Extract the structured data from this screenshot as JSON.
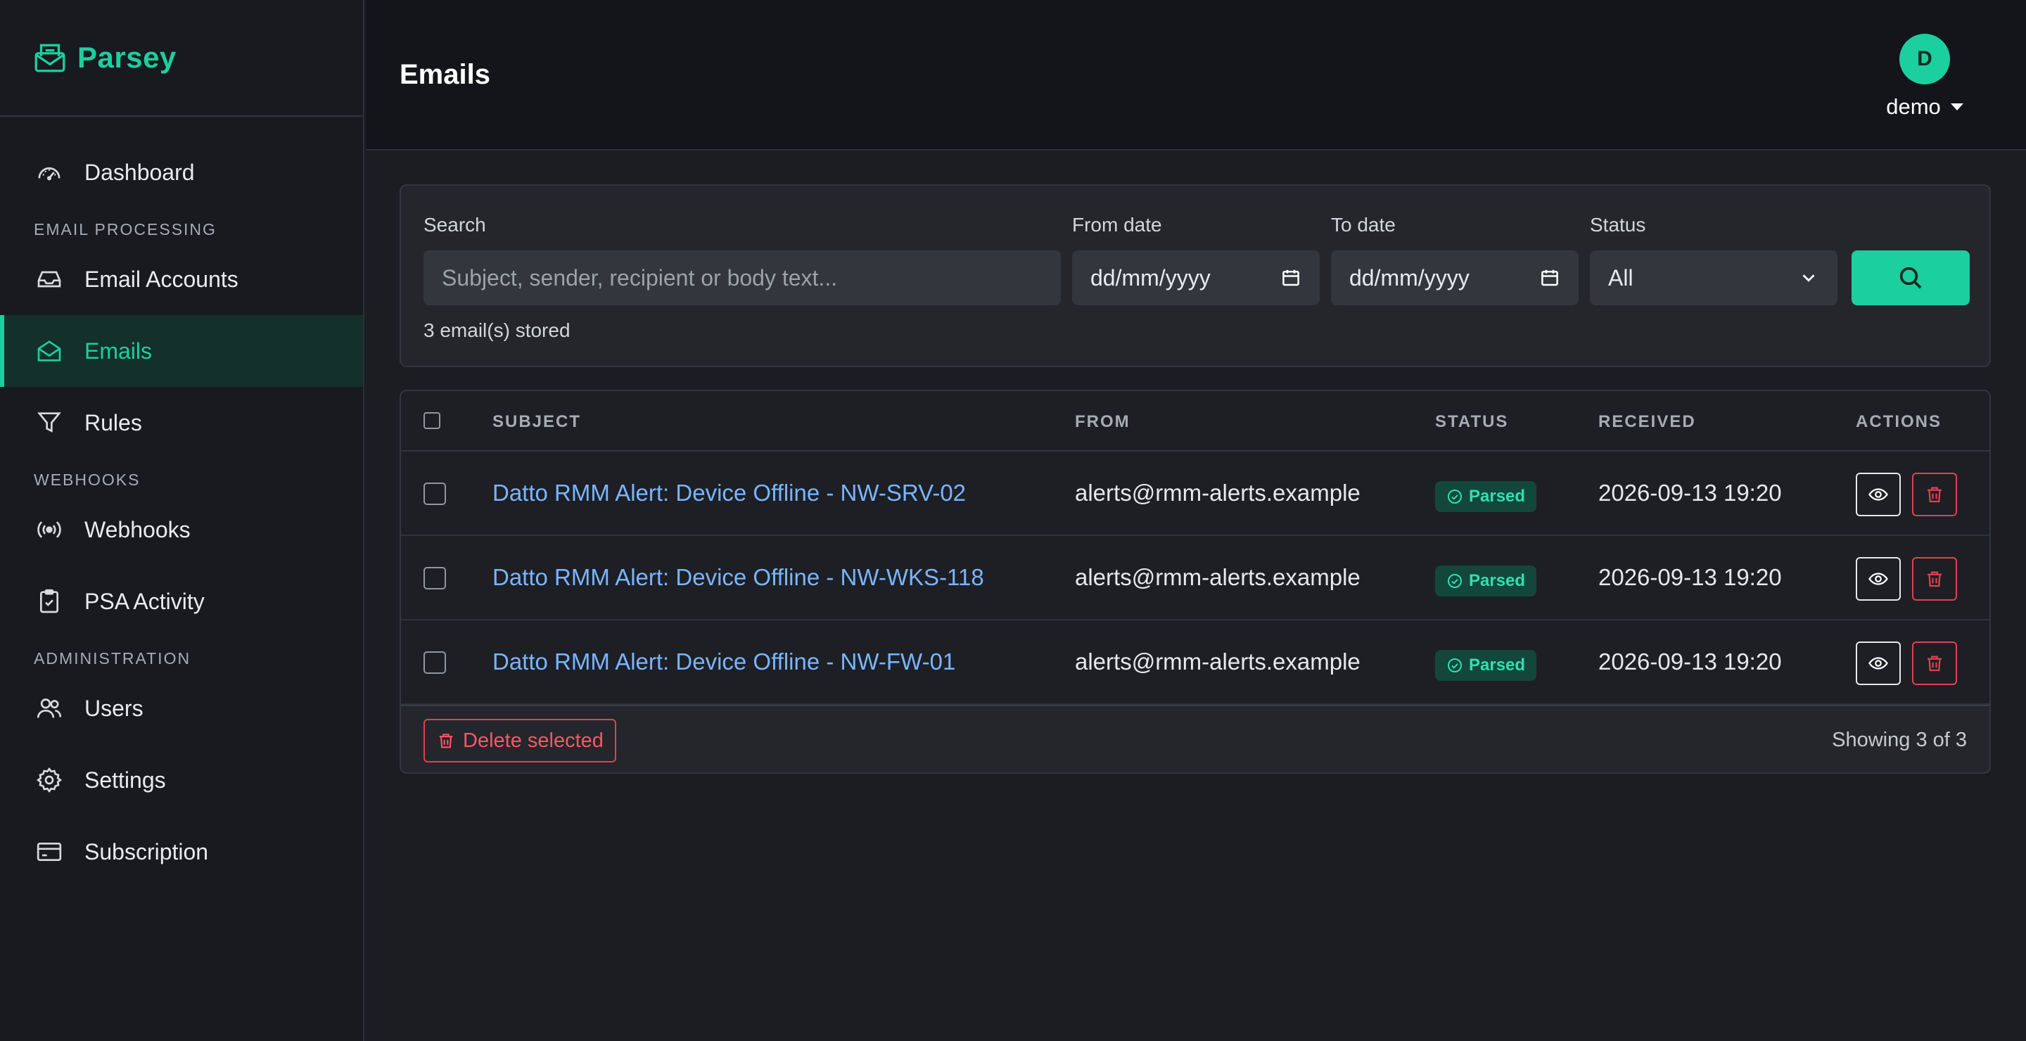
{
  "app": {
    "name": "Parsey"
  },
  "sidebar": {
    "items": [
      {
        "label": "Dashboard"
      },
      {
        "section": "EMAIL PROCESSING"
      },
      {
        "label": "Email Accounts"
      },
      {
        "label": "Emails",
        "active": true
      },
      {
        "label": "Rules"
      },
      {
        "section": "WEBHOOKS"
      },
      {
        "label": "Webhooks"
      },
      {
        "label": "PSA Activity"
      },
      {
        "section": "ADMINISTRATION"
      },
      {
        "label": "Users"
      },
      {
        "label": "Settings"
      },
      {
        "label": "Subscription"
      }
    ]
  },
  "header": {
    "title": "Emails",
    "user": {
      "initial": "D",
      "name": "demo"
    }
  },
  "filters": {
    "search_label": "Search",
    "search_placeholder": "Subject, sender, recipient or body text...",
    "from_label": "From date",
    "from_value": "dd/mm/yyyy",
    "to_label": "To date",
    "to_value": "dd/mm/yyyy",
    "status_label": "Status",
    "status_value": "All",
    "stored_text": "3 email(s) stored"
  },
  "table": {
    "columns": [
      "SUBJECT",
      "FROM",
      "STATUS",
      "RECEIVED",
      "ACTIONS"
    ],
    "rows": [
      {
        "subject": "Datto RMM Alert: Device Offline - NW-SRV-02",
        "from": "alerts@rmm-alerts.example",
        "status": "Parsed",
        "received": "2026-09-13 19:20"
      },
      {
        "subject": "Datto RMM Alert: Device Offline - NW-WKS-118",
        "from": "alerts@rmm-alerts.example",
        "status": "Parsed",
        "received": "2026-09-13 19:20"
      },
      {
        "subject": "Datto RMM Alert: Device Offline - NW-FW-01",
        "from": "alerts@rmm-alerts.example",
        "status": "Parsed",
        "received": "2026-09-13 19:20"
      }
    ],
    "delete_selected_label": "Delete selected",
    "showing_text": "Showing 3 of 3"
  },
  "colors": {
    "accent": "#1ccf9f",
    "link": "#7ab4ff",
    "danger": "#e0414f",
    "background": "#1b1d22"
  }
}
